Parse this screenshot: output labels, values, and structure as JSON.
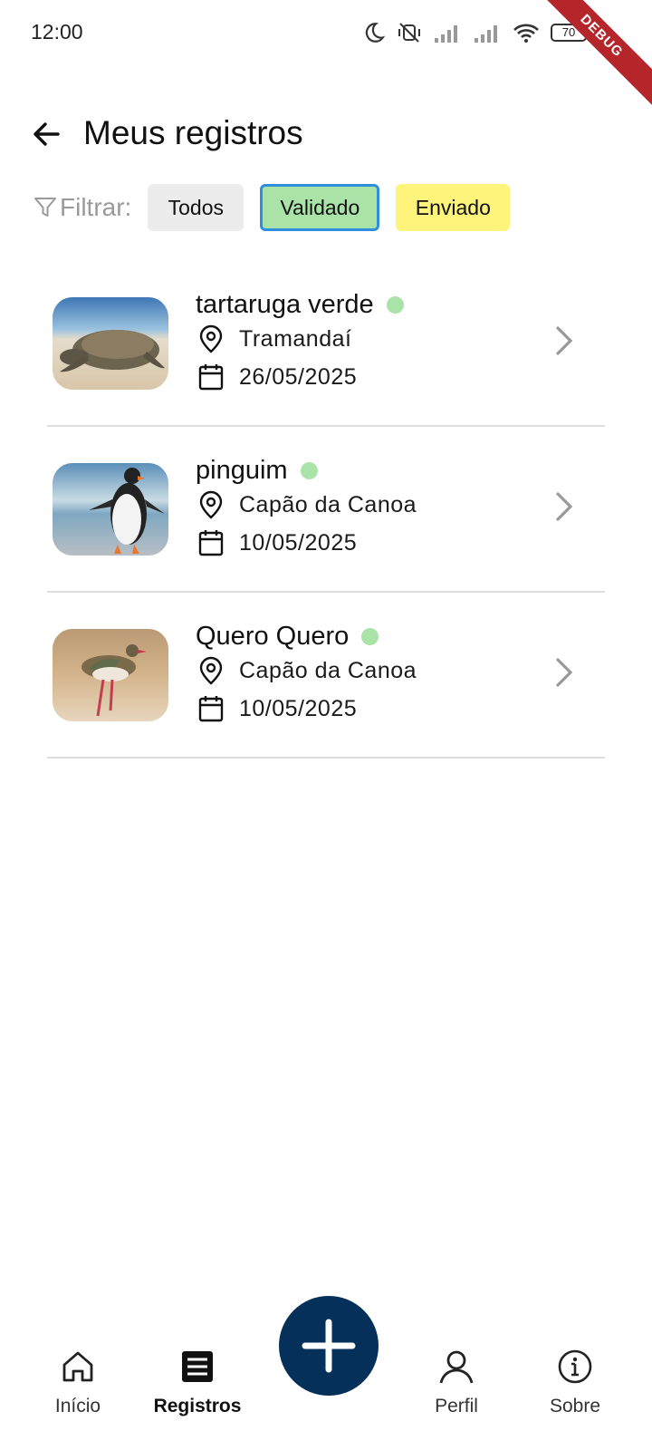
{
  "status_bar": {
    "time": "12:00",
    "battery": "70",
    "debug_label": "DEBUG"
  },
  "header": {
    "title": "Meus registros"
  },
  "filters": {
    "label": "Filtrar:",
    "options": [
      "Todos",
      "Validado",
      "Enviado"
    ],
    "selected": "Validado"
  },
  "colors": {
    "validated_dot": "#a9e3a8",
    "chip_validated": "#a9e3a8",
    "chip_sent": "#fff47b",
    "fab": "#053059"
  },
  "records": [
    {
      "name": "tartaruga verde",
      "location": "Tramandaí",
      "date": "26/05/2025",
      "status": "validated",
      "image": "sea-turtle-photo"
    },
    {
      "name": "pinguim",
      "location": "Capão da Canoa",
      "date": "10/05/2025",
      "status": "validated",
      "image": "penguin-photo"
    },
    {
      "name": "Quero Quero",
      "location": "Capão da Canoa",
      "date": "10/05/2025",
      "status": "validated",
      "image": "lapwing-photo"
    }
  ],
  "bottom_nav": {
    "items": [
      "Início",
      "Registros",
      "Perfil",
      "Sobre"
    ],
    "active": "Registros",
    "fab_icon": "plus-icon"
  }
}
